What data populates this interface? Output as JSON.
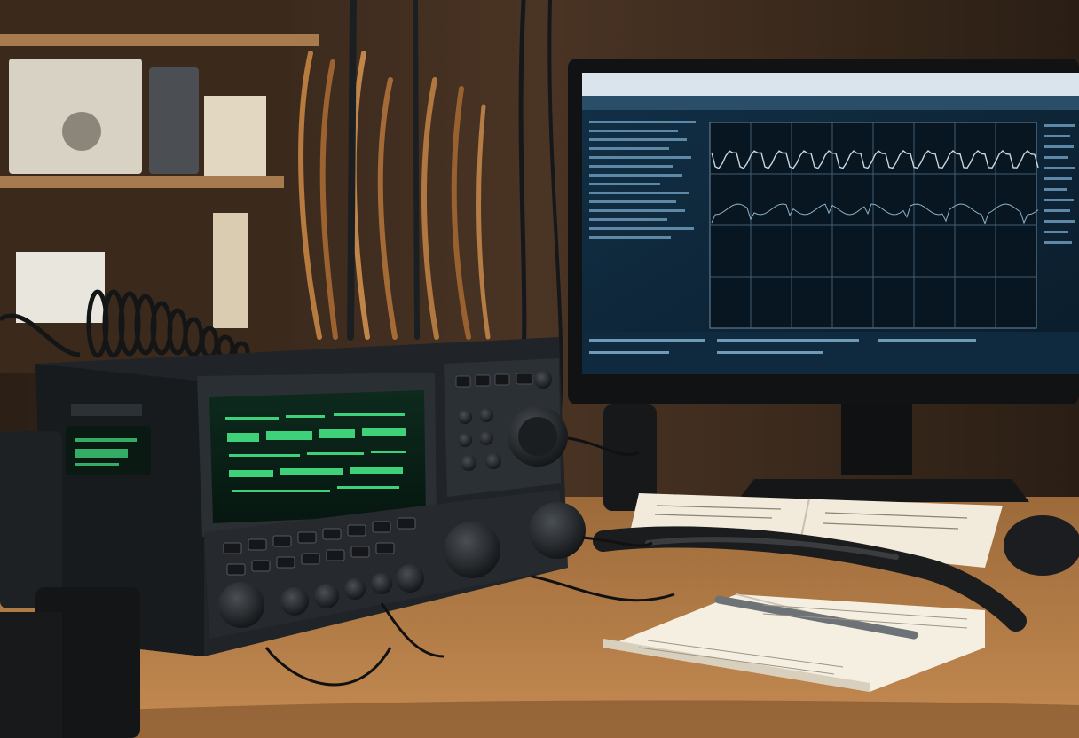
{
  "scene": {
    "description_tags": [
      "ham-radio-transceiver",
      "computer-monitor",
      "notebook",
      "microphone"
    ]
  },
  "radio": {
    "display_lines": [
      "",
      "",
      "",
      ""
    ]
  },
  "monitor": {
    "screen_color": "#0d2233",
    "trace_color": "#c9d6de"
  },
  "colors": {
    "desk": "#b27a45",
    "wall": "#3a2a1c",
    "radio_body": "#23272b",
    "lcd_green": "#3fd17a",
    "lcd_bg": "#0b1f16"
  }
}
